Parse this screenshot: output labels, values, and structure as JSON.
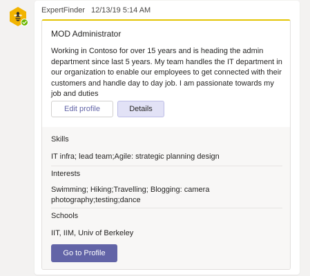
{
  "bot": {
    "avatar_icon": "bee-hexagon-icon",
    "presence_icon": "available-check-icon",
    "avatar_color": "#f2b400",
    "presence_color": "#6bb700"
  },
  "message": {
    "sender": "ExpertFinder",
    "timestamp": "12/13/19 5:14 AM"
  },
  "card": {
    "accent_color": "#e3c400",
    "name": "MOD Administrator",
    "bio": "Working in Contoso for over 15 years and is heading the admin department since last 5 years. My team handles the IT department in our organization to enable our employees to get connected with their customers and handle day to day job. I am passionate towards my job and duties",
    "buttons": {
      "edit_profile": "Edit profile",
      "details": "Details"
    },
    "sections": [
      {
        "label": "Skills",
        "value": "IT infra; lead team;Agile: strategic planning design"
      },
      {
        "label": "Interests",
        "value": "Swimming; Hiking;Travelling; Blogging: camera photography;testing;dance"
      },
      {
        "label": "Schools",
        "value": "IIT, IIM, Univ of Berkeley"
      }
    ],
    "go_to_profile": "Go to Profile",
    "primary_color": "#6264a7"
  }
}
